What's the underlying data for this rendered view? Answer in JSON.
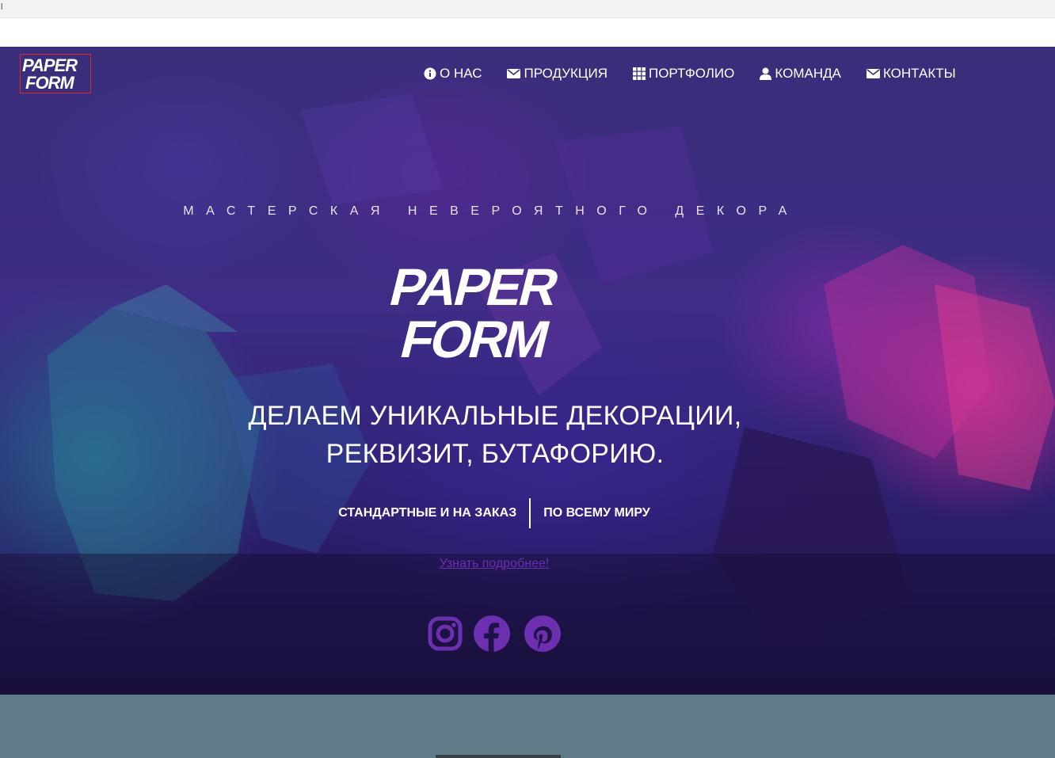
{
  "browser": {
    "top_mark": "l"
  },
  "brand": {
    "logo_line1": "PAPER",
    "logo_line2": "FORM"
  },
  "nav": {
    "items": [
      {
        "label": "О НАС",
        "icon": "info-circle-icon"
      },
      {
        "label": "ПРОДУКЦИЯ",
        "icon": "envelope-icon"
      },
      {
        "label": "ПОРТФОЛИО",
        "icon": "grid-icon"
      },
      {
        "label": "КОМАНДА",
        "icon": "user-icon"
      },
      {
        "label": "КОНТАКТЫ",
        "icon": "envelope-icon"
      }
    ]
  },
  "hero": {
    "tagline": "МАСТЕРСКАЯ НЕВЕРОЯТНОГО ДЕКОРА",
    "headline_line1": "ДЕЛАЕМ УНИКАЛЬНЫЕ ДЕКОРАЦИИ,",
    "headline_line2": "РЕКВИЗИТ, БУТАФОРИЮ.",
    "feature_left": "СТАНДАРТНЫЕ И НА ЗАКАЗ",
    "feature_right": "ПО ВСЕМУ МИРУ",
    "more_link": "Узнать подробнее!"
  },
  "socials": [
    {
      "name": "instagram-icon"
    },
    {
      "name": "facebook-icon"
    },
    {
      "name": "pinterest-icon"
    }
  ],
  "colors": {
    "accent_purple": "#6b2fb0",
    "hero_dark": "#1b1140",
    "bottom_section": "#5f7b88",
    "logo_border": "#d92b2b"
  }
}
